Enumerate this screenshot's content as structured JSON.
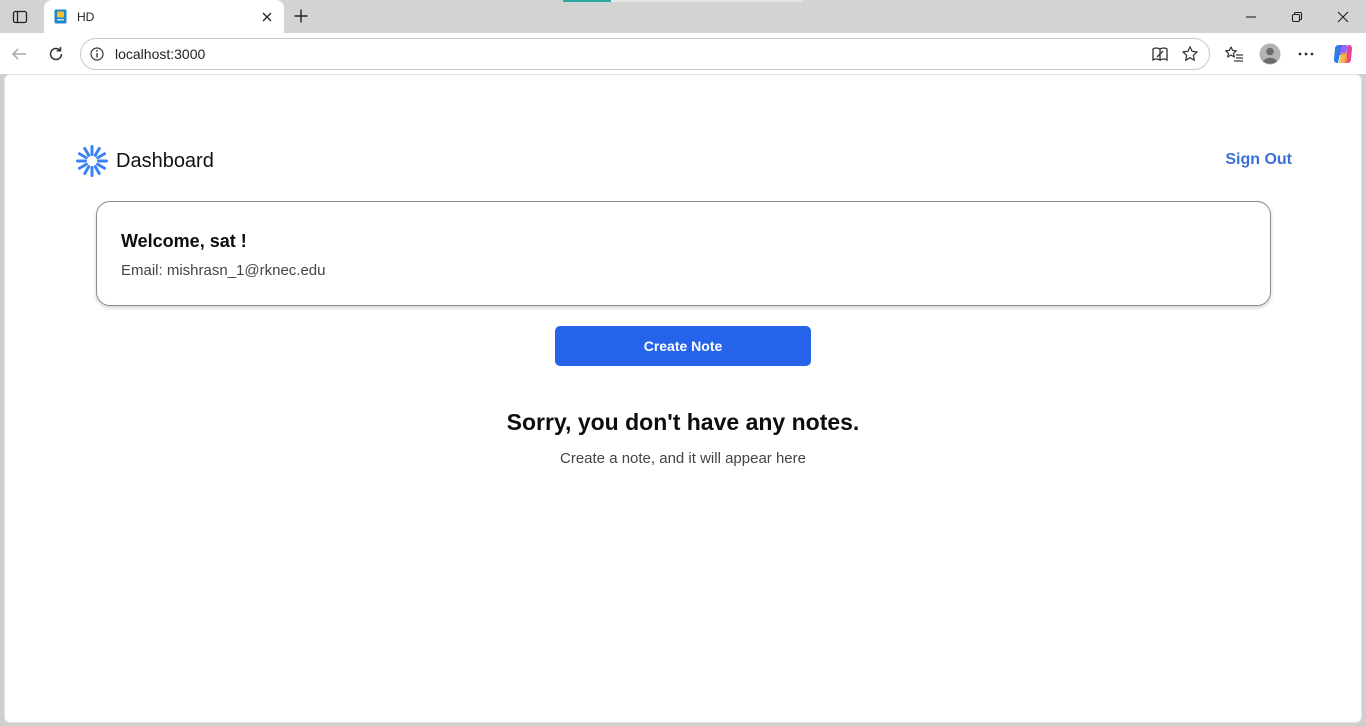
{
  "browser": {
    "tab": {
      "title": "HD",
      "favicon": "notebook-icon"
    },
    "address_bar": {
      "url": "localhost:3000"
    },
    "icons": {
      "sidebar": "tab-actions-icon",
      "close_tab": "close-icon",
      "new_tab": "plus-icon",
      "back": "back-arrow-icon",
      "reload": "reload-icon",
      "site_info": "info-icon",
      "read_aloud": "immersive-reader-icon",
      "favorite": "star-icon",
      "favorites": "favorites-list-icon",
      "profile": "profile-avatar-icon",
      "more": "more-options-icon",
      "copilot": "copilot-icon",
      "minimize": "minimize-icon",
      "restore": "restore-icon",
      "close_window": "close-window-icon"
    }
  },
  "app": {
    "header": {
      "logo": "spark-icon",
      "title": "Dashboard",
      "signout_label": "Sign Out"
    },
    "welcome": {
      "heading": "Welcome, sat !",
      "email_line": "Email: mishrasn_1@rknec.edu"
    },
    "create_note_label": "Create Note",
    "empty_state": {
      "title": "Sorry, you don't have any notes.",
      "subtitle": "Create a note, and it will appear here"
    }
  },
  "colors": {
    "accent_blue": "#2563eb",
    "link_blue": "#3b6fd8",
    "logo_blue": "#3b82f6"
  }
}
